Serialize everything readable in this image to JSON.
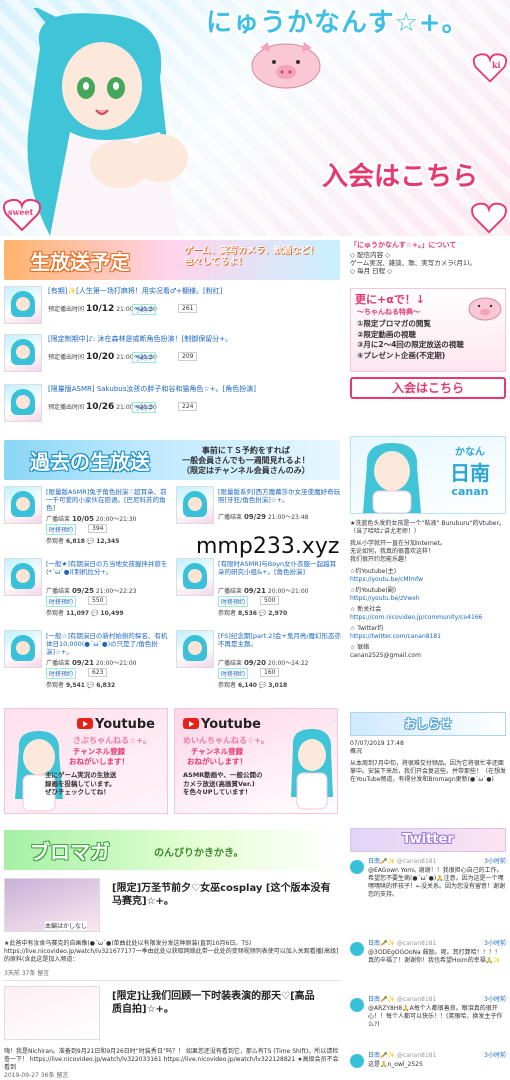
{
  "hero": {
    "title": "にゅうかなんす☆+。",
    "join_label": "入会はこちら",
    "heart_text": "sweet",
    "side_text": "ki"
  },
  "live": {
    "banner_title": "生放送予定",
    "banner_sub_line1": "ゲーム、実写カメラ、飲酒など！",
    "banner_sub_line2": "色々してるよ！",
    "items": [
      {
        "title": "[有期]✨[人生第一场打麻将！用实况看♂+棚様。[粉红]",
        "date_label": "预定播出时间",
        "date": "10/12",
        "time": "21:00～21:30",
        "res_label": "予約中",
        "count": "261"
      },
      {
        "title": "[限定制期中]♪: 沐在森林是或断角色扮演！[制御保留分+。",
        "date_label": "预定播出时间",
        "date": "10/20",
        "time": "21:00～21:30",
        "res_label": "予約中",
        "count": "209"
      },
      {
        "title": "[限量版ASMR] Sakubus汝孩の胖子和谷和猫角色☆+。[角色扮演]",
        "date_label": "预定播出时间",
        "date": "10/26",
        "time": "21:00～21:30",
        "res_label": "予約中",
        "count": "224"
      }
    ]
  },
  "past": {
    "banner_title": "過去の生放送",
    "banner_sub_line1": "事前にＴＳ予約をすれば",
    "banner_sub_line2": "一般会員さんでも一週間見れるよ！",
    "banner_sub_line3": "（限定はチャンネル会員さんのみ）",
    "items": [
      {
        "title": "[限量版ASMR]兔子角色扮演♡超耳朵、前一千可爱的小家伙在陪语。[巴尼科苏的角色]",
        "date_label": "广播结束",
        "date": "10/05",
        "time": "20:00～21:30",
        "ts_label": "时移预约",
        "ts_count": "394",
        "views_label": "参观者",
        "views": "6,818",
        "comments": "12,345"
      },
      {
        "title": "[限量版系列]西方魔幕莎尔女巫使魔好奇玩照[牙狂/角色扮演]☆+。",
        "date_label": "广播结束",
        "date": "09/29",
        "time": "21:00～23:48",
        "ts_label": "",
        "ts_count": "",
        "views_label": "",
        "views": "",
        "comments": ""
      },
      {
        "title": "[一般★]有期演日の方当地女孩握拌并旅を(*´ω`●)[制机拉分+。",
        "date_label": "广播结束",
        "date": "09/25",
        "time": "21:00～22:23",
        "ts_label": "时移预约",
        "ts_count": "550",
        "views_label": "参观者",
        "views": "11,097",
        "comments": "10,499"
      },
      {
        "title": "[有限时ASMR]与Boyn女仆衣服一起越耳朵的研究小组&+。[角色扮演]",
        "date_label": "广播结束",
        "date": "09/21",
        "time": "20:00～21:00",
        "ts_label": "时移预约",
        "ts_count": "500",
        "views_label": "参观者",
        "views": "8,536",
        "comments": "2,970"
      },
      {
        "title": "[一般☆]有期演日の新村始俯的探名、有机体日10,000(●´ω`●)の只是了/角色扮演]☆+。",
        "date_label": "广播结束",
        "date": "09/21",
        "time": "20:00～21:00",
        "ts_label": "时移预约",
        "ts_count": "623",
        "views_label": "参观者",
        "views": "9,541",
        "comments": "6,832"
      },
      {
        "title": "[FS]纪念期[part.2]会+鬼月亮/魔幻形态亦不再是主题。",
        "date_label": "广播结束",
        "date": "09/20",
        "time": "20:00～24:22",
        "ts_label": "时移预约",
        "ts_count": "160",
        "views_label": "参观者",
        "views": "6,140",
        "comments": "3,018"
      }
    ]
  },
  "youtube": [
    {
      "logo": "Youtube",
      "channel": "さぶちゃんねる☆+。",
      "subscribe": "チャンネル登録",
      "please": "おねがいします！",
      "desc_line1": "主にゲーム実況の生放送",
      "desc_line2": "録画を投稿しています。",
      "desc_line3": "ぜひチェックしてね！"
    },
    {
      "logo": "Youtube",
      "channel": "めいんちゃんねる☆+。",
      "subscribe": "チャンネル登録",
      "please": "おねがいします！",
      "desc_line1": "ASMR動画や、一般公開の",
      "desc_line2": "カメラ放送(高画質Ver.)",
      "desc_line3": "を色々UPしています！"
    }
  ],
  "promaga": {
    "banner_title": "ブロマガ",
    "banner_sub": "のんびりかきかき。",
    "articles": [
      {
        "title_line1": "[限定]万圣节前夕♡女巫cosplay [这个版本没有",
        "title_line2": "马赛克]☆+。",
        "thumb_label": "本編はかしなし",
        "text": "★此爸中有汝食马赛克的自画像(●´ω`●)单曲此处以有限发分发这种原装(直到10月6日。TS) https://live.nicovideo.jp/watch/lv321677177一季由此处以获取网络此带一此处的变频视频列表使可以加入关观看播[高级]的原料(含此这是加入频道：",
        "meta": "3天前 37条 留言"
      },
      {
        "title_line1": "[限定]让我们回顾一下时装表演的那天♡[高品",
        "title_line2": "质自拍]☆+。",
        "thumb_label": "",
        "text": "嗨！我是Nichiran。准备到9月21日和9月26日时“时装秀日”吗？！ 如果您还没有看到它，那么有TS (Time Shift)。所以请检查一下！ https://live.nicovideo.jp/watch/lv322033161 https://live.nicovideo.jp/watch/lv322128821 ★高级会员不会看到",
        "meta": "2019-09-27 36条 留言"
      }
    ]
  },
  "about": {
    "title": "「にゅうかなんす☆+。」について",
    "lines": [
      "◇ 配信内容 ◇",
      "ゲーム実況、雑談、歌、実写カメラ(月1)。",
      "◇ 毎月 日程 ◇"
    ]
  },
  "plus": {
    "title": "更に+αで！↓",
    "subtitle": "～ちゃんねる特典～",
    "items": [
      "①限定ブロマガの閲覧",
      "②限定動画の視聴",
      "③月に2～4回の限定放送の視聴",
      "④プレゼント企画(不定期)"
    ]
  },
  "join_button": "入会はこちら",
  "canan": {
    "name": "かなん",
    "kanji": "日南",
    "en": "canan"
  },
  "profile": {
    "intro": "★洗蓝色头发的女孩是一个“粘液” Buruburu“的Vtuber。（当了哈哈♪讲尤老师！）",
    "p1": "我从小学就开一直在分加Internet。",
    "p2": "无论如何，我真的很喜欢这样！",
    "p3": "我们很开约您能乐趣！",
    "yt_main_label": "☆约Youtube(主)",
    "yt_main_url": "https://youtu.be/cMlmfw",
    "yt_sub_label": "☆约Youtube(副)",
    "yt_sub_url": "https://youtu.be/zVwxh",
    "community_label": "☆ 新关社会",
    "community_url": "https://com.nicovideo.jp/community/co4166",
    "twitter_label": "☆ Twitter约",
    "twitter_url": "https://twitter.com/canan8181",
    "mail_label": "☆ 联络",
    "mail": "canan2525@gmail.com"
  },
  "notice": {
    "title": "おしらせ",
    "date": "07/07/2019 17:48",
    "head": "概况",
    "body": "从本周到7月中旬，将很难交付频品。因为它将很忙非还面掌中。安装下来后，我们开会复这些。并带那些！（在想发在YouTube频道，有得分发和Bromagn更新(●´ω`●)"
  },
  "twitter": {
    "title": "Twitter",
    "tweets": [
      {
        "name": "日南🥕✨",
        "handle": "@canan8181",
        "time": "3小时前",
        "text": "@EAGown Yomi, 谢谢！！我很担心自己的工作。希望您不要生病(●´ω`●)🙏注意。因为这是一个嘿嘿嘿哄的怀孩子！←没关系。因为您没有留意！谢谢您的支持。"
      },
      {
        "name": "日南🥕✨",
        "handle": "@canan8181",
        "time": "3小时前",
        "text": "@3ODEgOGOoNa 鼓励。呢。耳打算哈！！！！真的辛福了！谢谢你！我也希望Hoim的幸福🙏✨"
      },
      {
        "name": "日南🥕✨",
        "handle": "@canan8181",
        "time": "3小时前",
        "text": "@ARZY8H8🙏A每个人都很善良。眼泪真的很开心！！每个人都可以快乐！！(笑眼哈，换发主子作么?)"
      },
      {
        "name": "日南🥕✨",
        "handle": "@canan8181",
        "time": "3小时前",
        "text": "这是🙏n_owl_2525"
      }
    ]
  },
  "watermark": "mmp233.xyz",
  "colors": {
    "accent_pink": "#e8376f",
    "accent_blue": "#2aa6d6",
    "link_blue": "#1a66c5"
  }
}
